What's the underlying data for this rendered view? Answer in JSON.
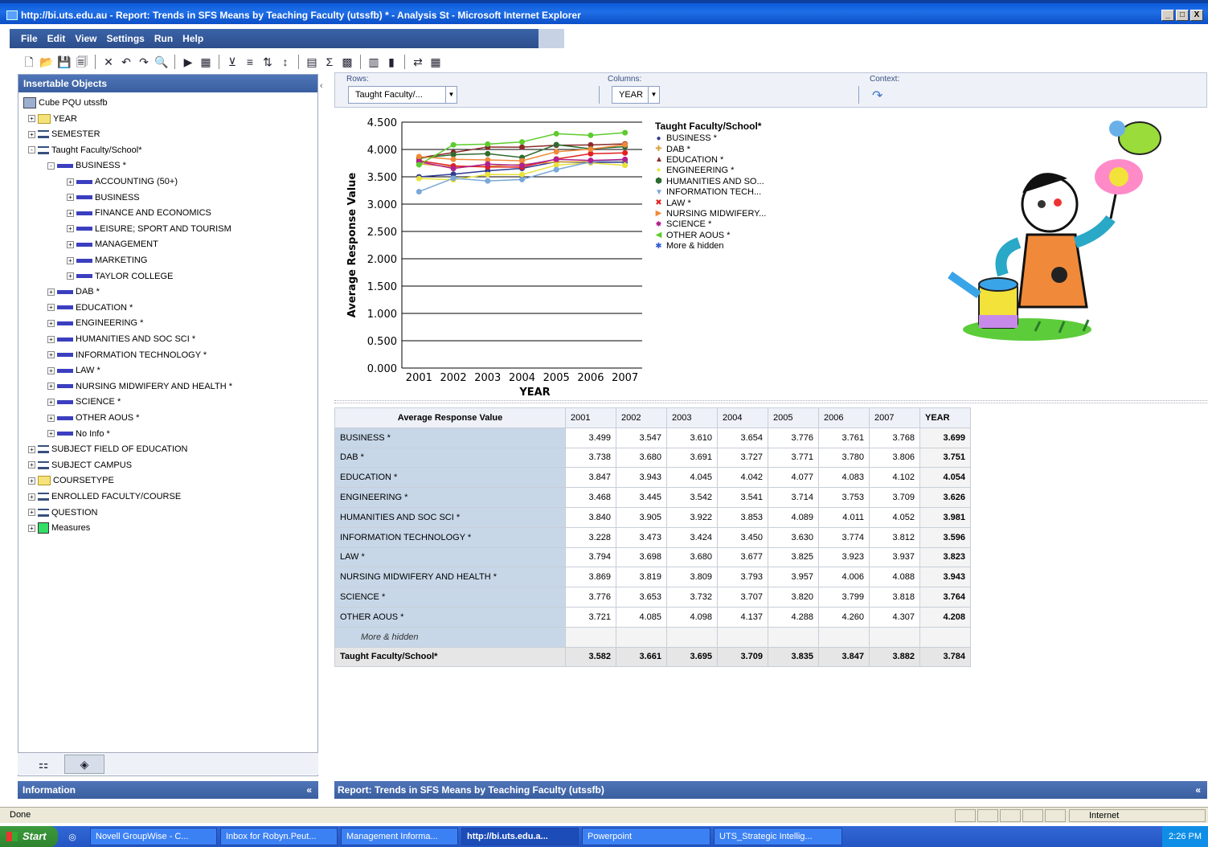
{
  "window": {
    "title": "http://bi.uts.edu.au - Report: Trends in SFS Means by Teaching Faculty (utssfb) * - Analysis St - Microsoft Internet Explorer",
    "min": "_",
    "max": "□",
    "close": "X"
  },
  "menu": [
    "File",
    "Edit",
    "View",
    "Settings",
    "Run",
    "Help"
  ],
  "left_pane": {
    "title": "Insertable Objects",
    "cube": "Cube PQU utssfb",
    "tree": [
      {
        "label": "YEAR",
        "icon": "folder",
        "level": 1,
        "exp": "+"
      },
      {
        "label": "SEMESTER",
        "icon": "hier",
        "level": 1,
        "exp": "+"
      },
      {
        "label": "Taught Faculty/School*",
        "icon": "hier",
        "level": 1,
        "exp": "-"
      },
      {
        "label": "BUSINESS *",
        "icon": "bar",
        "level": 2,
        "exp": "-"
      },
      {
        "label": "ACCOUNTING (50+)",
        "icon": "bar",
        "level": 3,
        "exp": "+"
      },
      {
        "label": "BUSINESS",
        "icon": "bar",
        "level": 3,
        "exp": "+"
      },
      {
        "label": "FINANCE AND ECONOMICS",
        "icon": "bar",
        "level": 3,
        "exp": "+"
      },
      {
        "label": "LEISURE; SPORT AND TOURISM",
        "icon": "bar",
        "level": 3,
        "exp": "+"
      },
      {
        "label": "MANAGEMENT",
        "icon": "bar",
        "level": 3,
        "exp": "+"
      },
      {
        "label": "MARKETING",
        "icon": "bar",
        "level": 3,
        "exp": "+"
      },
      {
        "label": "TAYLOR COLLEGE",
        "icon": "bar",
        "level": 3,
        "exp": "+"
      },
      {
        "label": "DAB *",
        "icon": "bar",
        "level": 2,
        "exp": "+"
      },
      {
        "label": "EDUCATION *",
        "icon": "bar",
        "level": 2,
        "exp": "+"
      },
      {
        "label": "ENGINEERING *",
        "icon": "bar",
        "level": 2,
        "exp": "+"
      },
      {
        "label": "HUMANITIES AND SOC SCI *",
        "icon": "bar",
        "level": 2,
        "exp": "+"
      },
      {
        "label": "INFORMATION TECHNOLOGY *",
        "icon": "bar",
        "level": 2,
        "exp": "+"
      },
      {
        "label": "LAW *",
        "icon": "bar",
        "level": 2,
        "exp": "+"
      },
      {
        "label": "NURSING MIDWIFERY AND HEALTH *",
        "icon": "bar",
        "level": 2,
        "exp": "+"
      },
      {
        "label": "SCIENCE *",
        "icon": "bar",
        "level": 2,
        "exp": "+"
      },
      {
        "label": "OTHER AOUS *",
        "icon": "bar",
        "level": 2,
        "exp": "+"
      },
      {
        "label": "No Info *",
        "icon": "bar",
        "level": 2,
        "exp": "+"
      },
      {
        "label": "SUBJECT FIELD OF EDUCATION",
        "icon": "hier",
        "level": 1,
        "exp": "+"
      },
      {
        "label": "SUBJECT CAMPUS",
        "icon": "hier",
        "level": 1,
        "exp": "+"
      },
      {
        "label": "COURSETYPE",
        "icon": "folder",
        "level": 1,
        "exp": "+"
      },
      {
        "label": "ENROLLED FACULTY/COURSE",
        "icon": "hier",
        "level": 1,
        "exp": "+"
      },
      {
        "label": "QUESTION",
        "icon": "hier",
        "level": 1,
        "exp": "+"
      },
      {
        "label": "Measures",
        "icon": "meas",
        "level": 1,
        "exp": "+"
      }
    ],
    "info_title": "Information"
  },
  "dropzone": {
    "rows_label": "Rows:",
    "rows_value": "Taught Faculty/...",
    "cols_label": "Columns:",
    "cols_value": "YEAR",
    "context_label": "Context:"
  },
  "chart_data": {
    "type": "line",
    "ylabel": "Average Response Value",
    "xlabel": "YEAR",
    "ylim": [
      0,
      4.5
    ],
    "yticks": [
      "0.000",
      "0.500",
      "1.000",
      "1.500",
      "2.000",
      "2.500",
      "3.000",
      "3.500",
      "4.000",
      "4.500"
    ],
    "categories": [
      "2001",
      "2002",
      "2003",
      "2004",
      "2005",
      "2006",
      "2007"
    ],
    "legend_title": "Taught Faculty/School*",
    "legend_extra": "More & hidden",
    "series": [
      {
        "name": "BUSINESS *",
        "color": "#2f3a8f",
        "marker": "●",
        "values": [
          3.499,
          3.547,
          3.61,
          3.654,
          3.776,
          3.761,
          3.768
        ]
      },
      {
        "name": "DAB *",
        "color": "#d7a43a",
        "marker": "✚",
        "values": [
          3.738,
          3.68,
          3.691,
          3.727,
          3.771,
          3.78,
          3.806
        ]
      },
      {
        "name": "EDUCATION *",
        "color": "#8b2a2a",
        "marker": "▲",
        "values": [
          3.847,
          3.943,
          4.045,
          4.042,
          4.077,
          4.083,
          4.102
        ]
      },
      {
        "name": "ENGINEERING *",
        "color": "#e8e23a",
        "marker": "✦",
        "values": [
          3.468,
          3.445,
          3.542,
          3.541,
          3.714,
          3.753,
          3.709
        ]
      },
      {
        "name": "HUMANITIES AND SO...",
        "color": "#2e6b2e",
        "marker": "⬢",
        "values": [
          3.84,
          3.905,
          3.922,
          3.853,
          4.089,
          4.011,
          4.052
        ]
      },
      {
        "name": "INFORMATION TECH...",
        "color": "#7aa8d8",
        "marker": "▼",
        "values": [
          3.228,
          3.473,
          3.424,
          3.45,
          3.63,
          3.774,
          3.812
        ]
      },
      {
        "name": "LAW *",
        "color": "#e02020",
        "marker": "✖",
        "values": [
          3.794,
          3.698,
          3.68,
          3.677,
          3.825,
          3.923,
          3.937
        ]
      },
      {
        "name": "NURSING MIDWIFERY...",
        "color": "#f08a3a",
        "marker": "▶",
        "values": [
          3.869,
          3.819,
          3.809,
          3.793,
          3.957,
          4.006,
          4.088
        ]
      },
      {
        "name": "SCIENCE *",
        "color": "#b0208f",
        "marker": "✸",
        "values": [
          3.776,
          3.653,
          3.732,
          3.707,
          3.82,
          3.799,
          3.818
        ]
      },
      {
        "name": "OTHER AOUS *",
        "color": "#5ccc2c",
        "marker": "◀",
        "values": [
          3.721,
          4.085,
          4.098,
          4.137,
          4.288,
          4.26,
          4.307
        ]
      }
    ]
  },
  "table": {
    "corner": "Average Response Value",
    "columns": [
      "2001",
      "2002",
      "2003",
      "2004",
      "2005",
      "2006",
      "2007",
      "YEAR"
    ],
    "rows": [
      {
        "label": "BUSINESS *",
        "values": [
          "3.499",
          "3.547",
          "3.610",
          "3.654",
          "3.776",
          "3.761",
          "3.768"
        ],
        "total": "3.699"
      },
      {
        "label": "DAB *",
        "values": [
          "3.738",
          "3.680",
          "3.691",
          "3.727",
          "3.771",
          "3.780",
          "3.806"
        ],
        "total": "3.751"
      },
      {
        "label": "EDUCATION *",
        "values": [
          "3.847",
          "3.943",
          "4.045",
          "4.042",
          "4.077",
          "4.083",
          "4.102"
        ],
        "total": "4.054"
      },
      {
        "label": "ENGINEERING *",
        "values": [
          "3.468",
          "3.445",
          "3.542",
          "3.541",
          "3.714",
          "3.753",
          "3.709"
        ],
        "total": "3.626"
      },
      {
        "label": "HUMANITIES AND SOC SCI *",
        "values": [
          "3.840",
          "3.905",
          "3.922",
          "3.853",
          "4.089",
          "4.011",
          "4.052"
        ],
        "total": "3.981"
      },
      {
        "label": "INFORMATION TECHNOLOGY *",
        "values": [
          "3.228",
          "3.473",
          "3.424",
          "3.450",
          "3.630",
          "3.774",
          "3.812"
        ],
        "total": "3.596"
      },
      {
        "label": "LAW *",
        "values": [
          "3.794",
          "3.698",
          "3.680",
          "3.677",
          "3.825",
          "3.923",
          "3.937"
        ],
        "total": "3.823"
      },
      {
        "label": "NURSING MIDWIFERY AND HEALTH *",
        "values": [
          "3.869",
          "3.819",
          "3.809",
          "3.793",
          "3.957",
          "4.006",
          "4.088"
        ],
        "total": "3.943"
      },
      {
        "label": "SCIENCE *",
        "values": [
          "3.776",
          "3.653",
          "3.732",
          "3.707",
          "3.820",
          "3.799",
          "3.818"
        ],
        "total": "3.764"
      },
      {
        "label": "OTHER AOUS *",
        "values": [
          "3.721",
          "4.085",
          "4.098",
          "4.137",
          "4.288",
          "4.260",
          "4.307"
        ],
        "total": "4.208"
      }
    ],
    "more_label": "More & hidden",
    "total_row": {
      "label": "Taught Faculty/School*",
      "values": [
        "3.582",
        "3.661",
        "3.695",
        "3.709",
        "3.835",
        "3.847",
        "3.882"
      ],
      "total": "3.784"
    }
  },
  "report_bar": "Report: Trends in SFS Means by Teaching Faculty (utssfb)",
  "status": {
    "text": "Done",
    "zone": "Internet"
  },
  "taskbar": {
    "start": "Start",
    "tasks": [
      "Novell GroupWise - C...",
      "Inbox for Robyn.Peut...",
      "Management Informa...",
      "http://bi.uts.edu.a...",
      "Powerpoint",
      "UTS_Strategic Intellig..."
    ],
    "active_index": 3,
    "clock": "2:26 PM"
  }
}
